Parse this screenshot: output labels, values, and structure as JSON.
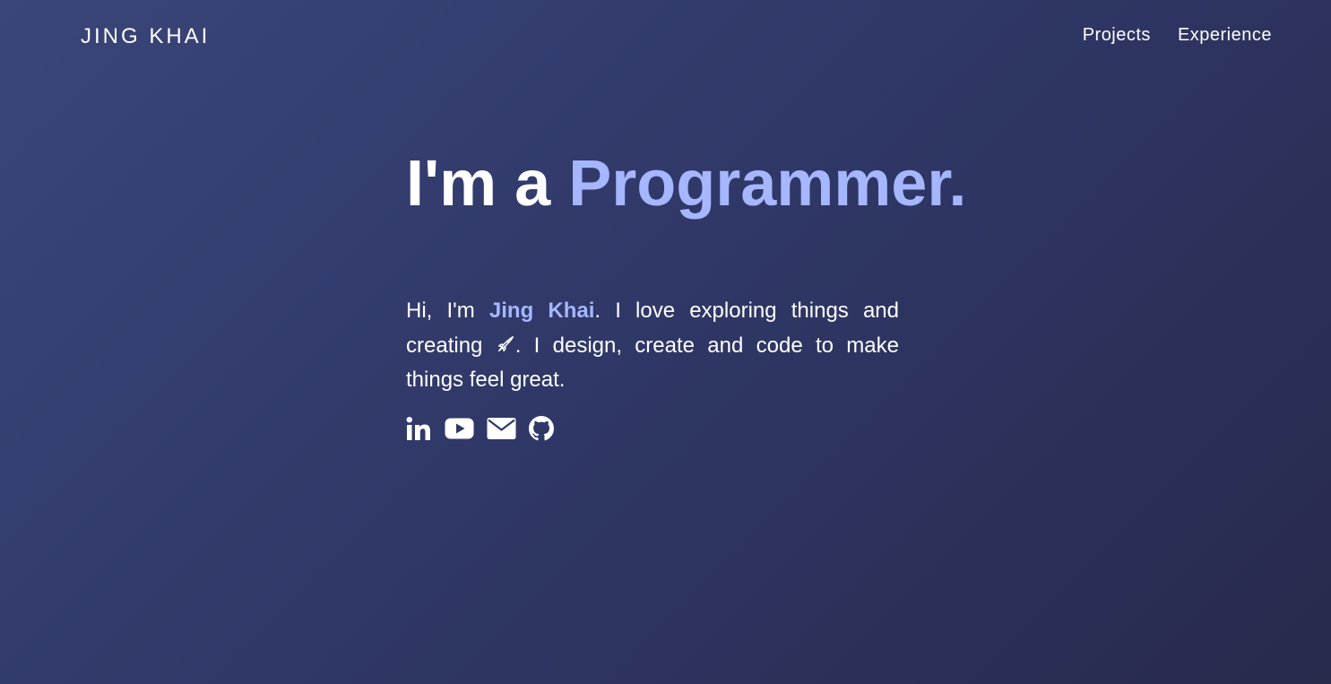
{
  "nav": {
    "brand": "JING KHAI",
    "links": [
      "Projects",
      "Experience"
    ]
  },
  "hero": {
    "headline_prefix": "I'm a ",
    "headline_accent": "Programmer.",
    "intro_before_name": "Hi, I'm ",
    "intro_name": "Jing Khai",
    "intro_after_name": ". I love exploring things and creating ",
    "intro_after_emoji": ". I design, create and code to make things feel great."
  },
  "icons": {
    "emoji": "rocket-icon",
    "socials": [
      "linkedin-icon",
      "youtube-icon",
      "email-icon",
      "github-icon"
    ]
  },
  "colors": {
    "background_start": "#3a4579",
    "background_end": "#282a4c",
    "accent": "#a6b6ff",
    "text": "#ffffff"
  }
}
